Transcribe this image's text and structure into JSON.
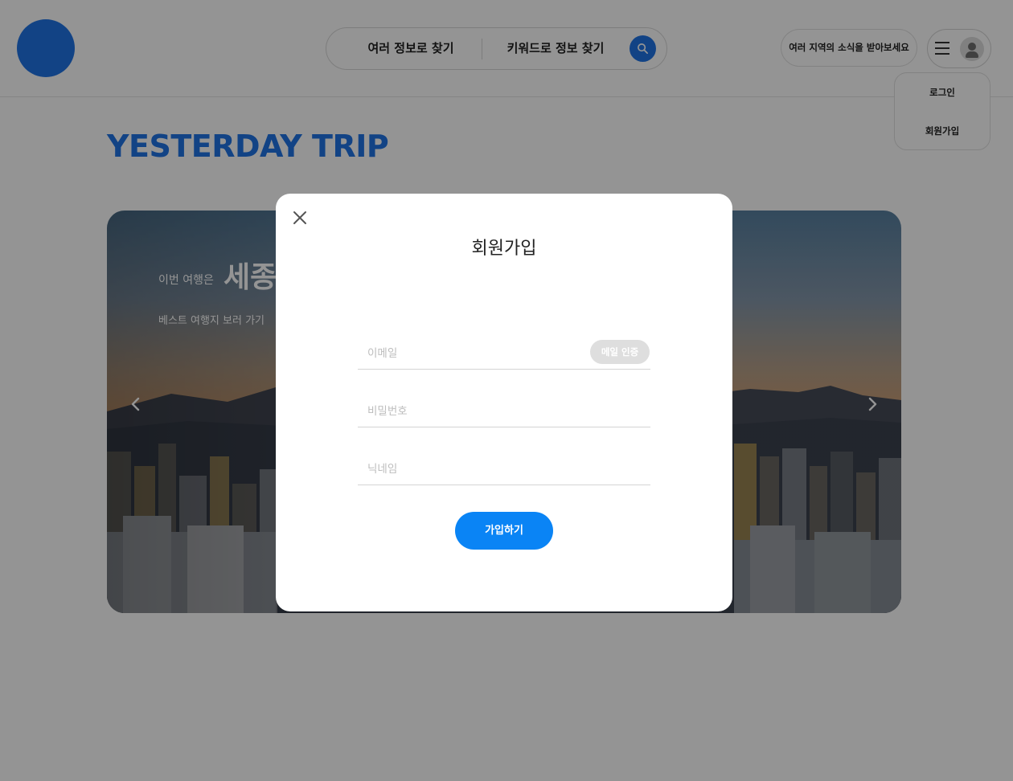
{
  "header": {
    "search_options": [
      "여러 정보로 찾기",
      "키워드로 정보 찾기"
    ],
    "news_button": "여러 지역의 소식을 받아보세요",
    "dropdown_items": [
      "로그인",
      "회원가입"
    ]
  },
  "main": {
    "site_title": "YESTERDAY TRIP",
    "banner": {
      "prefix": "이번 여행은",
      "city": "세종",
      "link": "베스트 여행지 보러 가기"
    }
  },
  "modal": {
    "title": "회원가입",
    "email_placeholder": "이메일",
    "verify_button": "메일 인증",
    "password_placeholder": "비밀번호",
    "nickname_placeholder": "닉네임",
    "submit_button": "가입하기"
  },
  "colors": {
    "brand": "#1f74e6",
    "submit": "#0a84f5",
    "overlay": "rgba(0,0,0,0.42)"
  }
}
